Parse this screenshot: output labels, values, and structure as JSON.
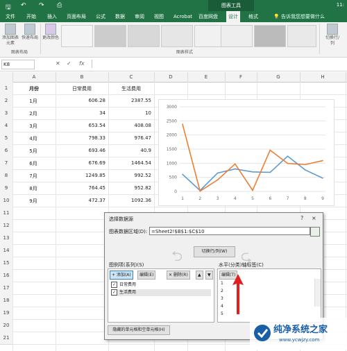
{
  "titlebar": {
    "chart_tools": "图表工具",
    "right": "11:"
  },
  "tabs": [
    "文件",
    "开始",
    "插入",
    "页面布局",
    "公式",
    "数据",
    "审阅",
    "视图",
    "Acrobat",
    "百度网盘",
    "设计",
    "格式"
  ],
  "active_tab": "设计",
  "tell_me": "告诉我您想要做什么",
  "ribbon": {
    "add_element": "添加图表元素",
    "quick_layout": "快速布局",
    "change_color": "更改颜色",
    "group_layout": "图表布局",
    "group_style": "图表样式",
    "switch_rowcol": "切换行/列"
  },
  "namebox": "K8",
  "fx": "fx",
  "columns": [
    "A",
    "B",
    "C",
    "D",
    "E",
    "F",
    "G",
    "H"
  ],
  "rows": [
    "1",
    "2",
    "3",
    "4",
    "5",
    "6",
    "7",
    "8",
    "9",
    "10",
    "11",
    "12",
    "13",
    "14",
    "15",
    "16",
    "17",
    "18",
    "19",
    "20",
    "21"
  ],
  "table": {
    "headers": [
      "月份",
      "日常费用",
      "生活费用"
    ],
    "data": [
      [
        "1月",
        "606.28",
        "2387.55"
      ],
      [
        "2月",
        "34",
        "10"
      ],
      [
        "3月",
        "653.54",
        "408.08"
      ],
      [
        "4月",
        "798.33",
        "976.47"
      ],
      [
        "5月",
        "693.46",
        "40.9"
      ],
      [
        "6月",
        "676.69",
        "1464.54"
      ],
      [
        "7月",
        "1249.85",
        "992.52"
      ],
      [
        "8月",
        "764.45",
        "952.82"
      ],
      [
        "9月",
        "472.37",
        "1092.36"
      ]
    ]
  },
  "chart_data": {
    "type": "line",
    "x": [
      "1",
      "2",
      "3",
      "4",
      "5",
      "6",
      "7",
      "8",
      "9"
    ],
    "ylim": [
      0,
      3000
    ],
    "yticks": [
      "3000",
      "2500",
      "2000",
      "1500",
      "1000",
      "500",
      "0"
    ],
    "series": [
      {
        "values": [
          606.28,
          34,
          653.54,
          798.33,
          693.46,
          676.69,
          1249.85,
          764.45,
          472.37
        ],
        "color": "#5b9bd5"
      },
      {
        "values": [
          2387.55,
          10,
          408.08,
          976.47,
          40.9,
          1464.54,
          992.52,
          952.82,
          1092.36
        ],
        "color": "#ed7d31"
      }
    ]
  },
  "dialog": {
    "title": "选择数据源",
    "help": "?",
    "close": "×",
    "range_label": "图表数据区域(D):",
    "range_value": "=Sheet2!$B$1:$C$10",
    "switch_label": "切换行/列(W)",
    "legend_label": "图例项(系列)(S)",
    "axis_label": "水平(分类)轴标签(C)",
    "add": "添加(A)",
    "edit": "编辑(E)",
    "delete": "删除(R)",
    "axis_edit": "编辑(T)",
    "series_list": [
      "日常费用",
      "生活费用"
    ],
    "axis_list": [
      "1",
      "2",
      "3",
      "4",
      "5"
    ],
    "hidden_cells": "隐藏的单元格和空单元格(H)"
  },
  "watermark": {
    "text": "纯净系统之家",
    "url": "www.ycwjzy.com"
  }
}
